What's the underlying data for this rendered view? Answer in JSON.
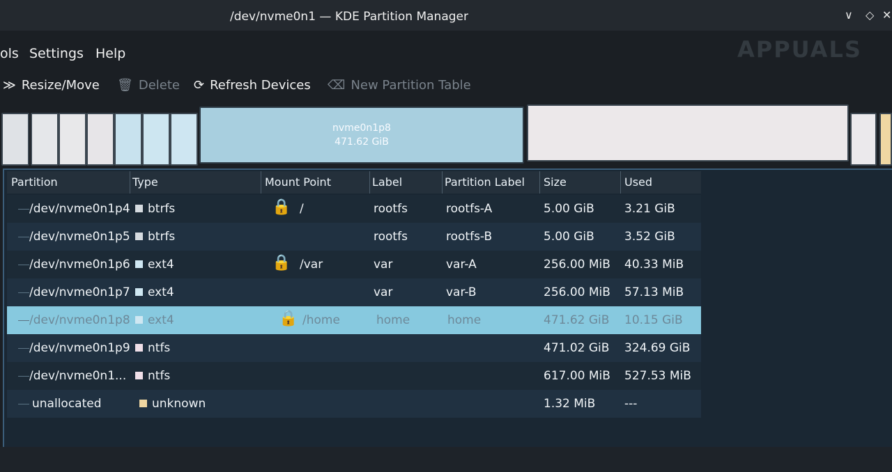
{
  "window": {
    "title": "/dev/nvme0n1 — KDE Partition Manager",
    "controls": [
      "∨",
      "◇",
      "✕"
    ]
  },
  "logo": "APPUALS",
  "menu": [
    "ols",
    "Settings",
    "Help"
  ],
  "toolbar": {
    "resize": "Resize/Move",
    "delete": "Delete",
    "refresh": "Refresh Devices",
    "new_table": "New Partition Table"
  },
  "partition_bar": {
    "selected_name": "nvme0n1p8",
    "selected_size": "471.62 GiB"
  },
  "columns": [
    "Partition",
    "Type",
    "Mount Point",
    "Label",
    "Partition Label",
    "Size",
    "Used"
  ],
  "rows": [
    {
      "partition": "/dev/nvme0n1p4",
      "type": "btrfs",
      "mount": "/",
      "label": "rootfs",
      "plabel": "rootfs-A",
      "size": "5.00 GiB",
      "used": "3.21 GiB",
      "locked": true,
      "color": "#d6dbe0"
    },
    {
      "partition": "/dev/nvme0n1p5",
      "type": "btrfs",
      "mount": "",
      "label": "rootfs",
      "plabel": "rootfs-B",
      "size": "5.00 GiB",
      "used": "3.52 GiB",
      "locked": false,
      "color": "#d6dbe0"
    },
    {
      "partition": "/dev/nvme0n1p6",
      "type": "ext4",
      "mount": "/var",
      "label": "var",
      "plabel": "var-A",
      "size": "256.00 MiB",
      "used": "40.33 MiB",
      "locked": true,
      "color": "#cfe7f2"
    },
    {
      "partition": "/dev/nvme0n1p7",
      "type": "ext4",
      "mount": "",
      "label": "var",
      "plabel": "var-B",
      "size": "256.00 MiB",
      "used": "57.13 MiB",
      "locked": false,
      "color": "#cfe7f2"
    },
    {
      "partition": "/dev/nvme0n1p8",
      "type": "ext4",
      "mount": "/home",
      "label": "home",
      "plabel": "home",
      "size": "471.62 GiB",
      "used": "10.15 GiB",
      "locked": true,
      "color": "#cfe7f2",
      "selected": true
    },
    {
      "partition": "/dev/nvme0n1p9",
      "type": "ntfs",
      "mount": "",
      "label": "",
      "plabel": "",
      "size": "471.02 GiB",
      "used": "324.69 GiB",
      "locked": false,
      "color": "#f0dfe8"
    },
    {
      "partition": "/dev/nvme0n1...",
      "type": "ntfs",
      "mount": "",
      "label": "",
      "plabel": "",
      "size": "617.00 MiB",
      "used": "527.53 MiB",
      "locked": false,
      "color": "#f0dfe8"
    },
    {
      "partition": "unallocated",
      "type": "unknown",
      "mount": "",
      "label": "",
      "plabel": "",
      "size": "1.32 MiB",
      "used": "---",
      "locked": false,
      "color": "#f0d7a2"
    }
  ]
}
